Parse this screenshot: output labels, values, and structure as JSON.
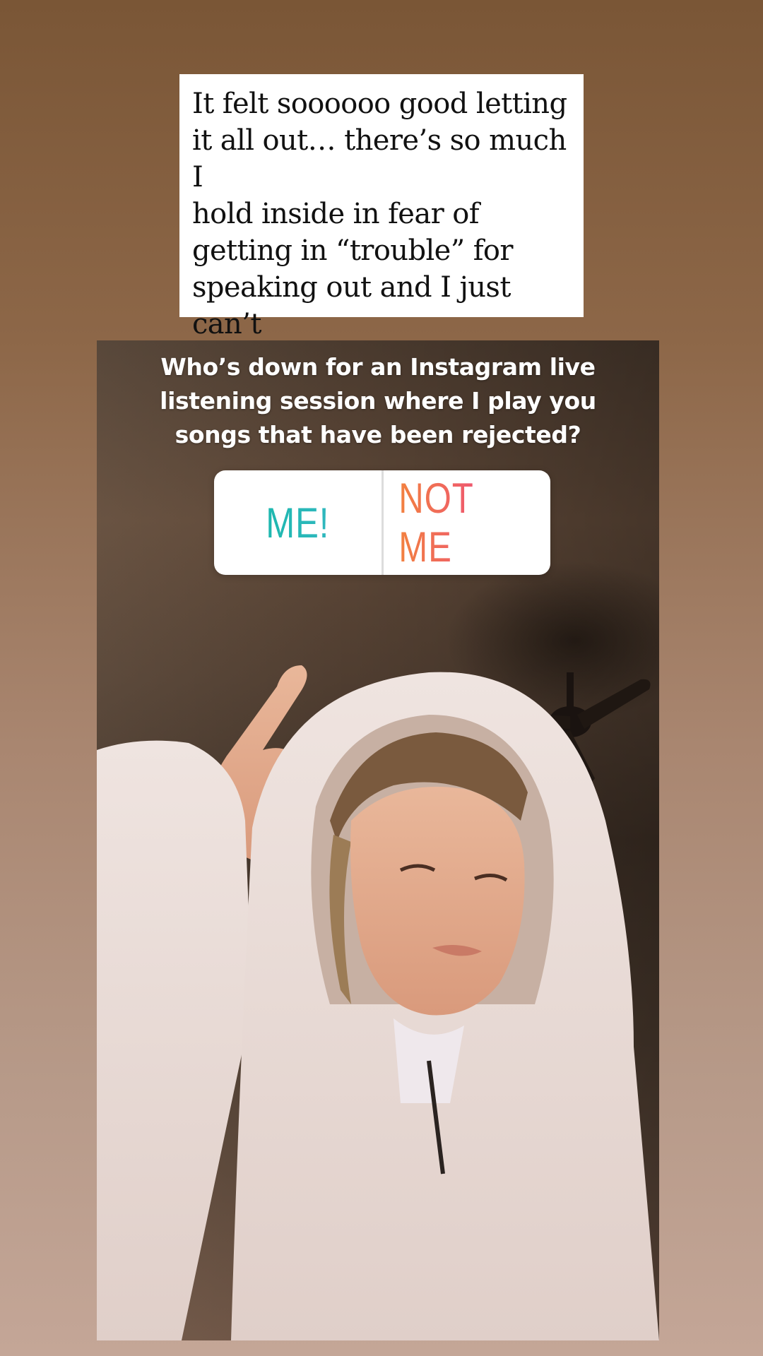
{
  "caption": {
    "text": "It felt soooooo good letting\nit all out… there’s so much I\nhold inside in fear of\ngetting in “trouble” for\nspeaking out and I just can’t\ndo it anymore… therefore…"
  },
  "poll": {
    "question": "Who’s down for an Instagram live\nlistening session where I play you\nsongs that have been rejected?",
    "options": [
      {
        "label": "ME!",
        "color": "#13b8a5"
      },
      {
        "label": "NOT ME",
        "color": "#ef5c6b"
      }
    ]
  },
  "colors": {
    "background_top": "#7a5636",
    "background_bottom": "#c4a697",
    "sticker_bg": "#ffffff"
  }
}
